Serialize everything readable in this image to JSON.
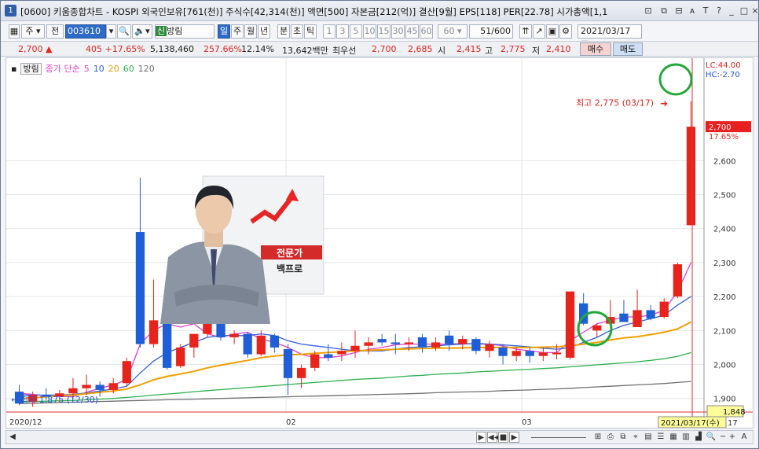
{
  "titlebar": {
    "number": "1",
    "text": "[0600] 키움종합차트 - KOSPI 외국인보유[761(천)] 주식수[42,314(천)] 액면[500] 자본금[212(억)] 결산[9월] EPS[118] PER[22.78] 시가총액[1,1"
  },
  "window_buttons": [
    "⊡",
    "⧉",
    "⊟",
    "ᴀ",
    "T",
    "?",
    "_",
    "□",
    "×"
  ],
  "toolbar": {
    "type": "주",
    "mode": "전",
    "code": "003610",
    "name_badge": "신",
    "name": "방림",
    "periods": [
      "일",
      "주",
      "월",
      "년",
      "분",
      "초",
      "틱"
    ],
    "period_selected": "일",
    "intervals": [
      "1",
      "3",
      "5",
      "10",
      "15",
      "30",
      "45",
      "60"
    ],
    "interval_value": "60",
    "count": "51",
    "count_total": "/600",
    "date": "2021/03/17"
  },
  "quote": {
    "price": "2,700",
    "arrow": "▲",
    "change": "405",
    "rate": "+17.65%",
    "volume": "5,138,460",
    "vol_rate": "257.66%",
    "turnover": "12.14%",
    "amount": "13,642백만",
    "pref_label": "최우선",
    "ask": "2,700",
    "bid": "2,685",
    "open_label": "시",
    "open": "2,415",
    "high_label": "고",
    "high": "2,775",
    "low_label": "저",
    "low": "2,410",
    "buy": "매수",
    "sell": "매도"
  },
  "legend": {
    "name": "방림",
    "title": "종가 단순",
    "ma": [
      {
        "label": "5",
        "color": "#e040d0"
      },
      {
        "label": "10",
        "color": "#3060e0"
      },
      {
        "label": "20",
        "color": "#f0a000"
      },
      {
        "label": "60",
        "color": "#30b050"
      },
      {
        "label": "120",
        "color": "#707070"
      }
    ]
  },
  "chart_data": {
    "type": "candlestick",
    "title": "방림",
    "ylim": [
      1860,
      2860
    ],
    "yticks": [
      1900,
      2000,
      2100,
      2200,
      2300,
      2400,
      2500,
      2600
    ],
    "xlabels": [
      "2020/12",
      "02",
      "03"
    ],
    "candles": [
      {
        "o": 1920,
        "h": 1940,
        "l": 1880,
        "c": 1885
      },
      {
        "o": 1890,
        "h": 1920,
        "l": 1875,
        "c": 1910
      },
      {
        "o": 1910,
        "h": 1930,
        "l": 1895,
        "c": 1905
      },
      {
        "o": 1905,
        "h": 1925,
        "l": 1890,
        "c": 1915
      },
      {
        "o": 1915,
        "h": 1960,
        "l": 1900,
        "c": 1930
      },
      {
        "o": 1930,
        "h": 1970,
        "l": 1910,
        "c": 1940
      },
      {
        "o": 1940,
        "h": 1950,
        "l": 1905,
        "c": 1925
      },
      {
        "o": 1925,
        "h": 1960,
        "l": 1915,
        "c": 1945
      },
      {
        "o": 1945,
        "h": 2020,
        "l": 1935,
        "c": 2010
      },
      {
        "o": 2390,
        "h": 2550,
        "l": 2050,
        "c": 2060
      },
      {
        "o": 2060,
        "h": 2250,
        "l": 2050,
        "c": 2130
      },
      {
        "o": 2130,
        "h": 2130,
        "l": 1985,
        "c": 1990
      },
      {
        "o": 1995,
        "h": 2060,
        "l": 1990,
        "c": 2050
      },
      {
        "o": 2050,
        "h": 2080,
        "l": 2020,
        "c": 2090
      },
      {
        "o": 2090,
        "h": 2150,
        "l": 2080,
        "c": 2120
      },
      {
        "o": 2130,
        "h": 2145,
        "l": 2070,
        "c": 2080
      },
      {
        "o": 2080,
        "h": 2100,
        "l": 2060,
        "c": 2090
      },
      {
        "o": 2090,
        "h": 2095,
        "l": 2020,
        "c": 2030
      },
      {
        "o": 2030,
        "h": 2100,
        "l": 2025,
        "c": 2085
      },
      {
        "o": 2085,
        "h": 2090,
        "l": 2035,
        "c": 2050
      },
      {
        "o": 2045,
        "h": 2060,
        "l": 1910,
        "c": 1960
      },
      {
        "o": 1960,
        "h": 2000,
        "l": 1930,
        "c": 1990
      },
      {
        "o": 1990,
        "h": 2040,
        "l": 1980,
        "c": 2030
      },
      {
        "o": 2030,
        "h": 2060,
        "l": 2010,
        "c": 2020
      },
      {
        "o": 2030,
        "h": 2065,
        "l": 2010,
        "c": 2040
      },
      {
        "o": 2040,
        "h": 2100,
        "l": 2020,
        "c": 2055
      },
      {
        "o": 2055,
        "h": 2080,
        "l": 2030,
        "c": 2065
      },
      {
        "o": 2075,
        "h": 2090,
        "l": 2055,
        "c": 2065
      },
      {
        "o": 2065,
        "h": 2090,
        "l": 2030,
        "c": 2060
      },
      {
        "o": 2060,
        "h": 2080,
        "l": 2040,
        "c": 2065
      },
      {
        "o": 2080,
        "h": 2090,
        "l": 2035,
        "c": 2050
      },
      {
        "o": 2050,
        "h": 2080,
        "l": 2040,
        "c": 2065
      },
      {
        "o": 2085,
        "h": 2100,
        "l": 2040,
        "c": 2060
      },
      {
        "o": 2060,
        "h": 2085,
        "l": 2045,
        "c": 2075
      },
      {
        "o": 2075,
        "h": 2080,
        "l": 2030,
        "c": 2040
      },
      {
        "o": 2040,
        "h": 2070,
        "l": 2020,
        "c": 2060
      },
      {
        "o": 2050,
        "h": 2060,
        "l": 2000,
        "c": 2025
      },
      {
        "o": 2025,
        "h": 2050,
        "l": 2010,
        "c": 2040
      },
      {
        "o": 2040,
        "h": 2050,
        "l": 2005,
        "c": 2025
      },
      {
        "o": 2025,
        "h": 2050,
        "l": 2010,
        "c": 2035
      },
      {
        "o": 2030,
        "h": 2060,
        "l": 2015,
        "c": 2035
      },
      {
        "o": 2020,
        "h": 2210,
        "l": 2015,
        "c": 2215
      },
      {
        "o": 2180,
        "h": 2210,
        "l": 2115,
        "c": 2120
      },
      {
        "o": 2100,
        "h": 2120,
        "l": 2080,
        "c": 2115
      },
      {
        "o": 2120,
        "h": 2190,
        "l": 2110,
        "c": 2140
      },
      {
        "o": 2150,
        "h": 2190,
        "l": 2130,
        "c": 2125
      },
      {
        "o": 2110,
        "h": 2220,
        "l": 2110,
        "c": 2160
      },
      {
        "o": 2160,
        "h": 2175,
        "l": 2130,
        "c": 2135
      },
      {
        "o": 2140,
        "h": 2195,
        "l": 2135,
        "c": 2185
      },
      {
        "o": 2200,
        "h": 2300,
        "l": 2195,
        "c": 2295
      },
      {
        "o": 2410,
        "h": 2775,
        "l": 2410,
        "c": 2700
      }
    ],
    "ma5": [
      1915,
      1912,
      1908,
      1906,
      1905,
      1918,
      1930,
      1940,
      1955,
      2060,
      2100,
      2120,
      2110,
      2120,
      2090,
      2080,
      2090,
      2095,
      2075,
      2065,
      2050,
      2030,
      2020,
      2020,
      2025,
      2035,
      2045,
      2050,
      2058,
      2060,
      2060,
      2060,
      2060,
      2062,
      2060,
      2060,
      2055,
      2045,
      2040,
      2035,
      2035,
      2070,
      2095,
      2120,
      2130,
      2140,
      2140,
      2145,
      2160,
      2215,
      2300
    ],
    "ma10": [
      1910,
      1910,
      1910,
      1910,
      1912,
      1916,
      1922,
      1928,
      1936,
      1975,
      2010,
      2035,
      2050,
      2065,
      2080,
      2085,
      2085,
      2085,
      2090,
      2085,
      2070,
      2060,
      2055,
      2050,
      2045,
      2040,
      2040,
      2040,
      2045,
      2050,
      2052,
      2055,
      2058,
      2060,
      2062,
      2060,
      2058,
      2055,
      2052,
      2048,
      2045,
      2050,
      2065,
      2080,
      2100,
      2115,
      2125,
      2135,
      2145,
      2175,
      2200
    ],
    "ma20": [
      1900,
      1902,
      1905,
      1908,
      1910,
      1914,
      1918,
      1922,
      1928,
      1940,
      1955,
      1965,
      1972,
      1980,
      1990,
      1998,
      2005,
      2012,
      2020,
      2025,
      2028,
      2030,
      2033,
      2035,
      2038,
      2040,
      2042,
      2043,
      2045,
      2046,
      2047,
      2048,
      2048,
      2049,
      2050,
      2050,
      2050,
      2050,
      2050,
      2051,
      2052,
      2055,
      2060,
      2065,
      2072,
      2078,
      2082,
      2088,
      2095,
      2105,
      2125
    ],
    "ma60": [
      1890,
      1891,
      1892,
      1893,
      1894,
      1896,
      1898,
      1900,
      1903,
      1906,
      1910,
      1913,
      1916,
      1920,
      1923,
      1926,
      1929,
      1932,
      1935,
      1938,
      1941,
      1944,
      1947,
      1950,
      1953,
      1956,
      1958,
      1960,
      1963,
      1966,
      1968,
      1971,
      1973,
      1975,
      1978,
      1980,
      1982,
      1984,
      1986,
      1988,
      1990,
      1993,
      1996,
      1999,
      2002,
      2005,
      2008,
      2012,
      2017,
      2024,
      2035
    ],
    "ma120": [
      1885,
      1886,
      1887,
      1888,
      1889,
      1890,
      1891,
      1892,
      1893,
      1894,
      1895,
      1896,
      1897,
      1898,
      1899,
      1900,
      1901,
      1902,
      1903,
      1904,
      1905,
      1906,
      1907,
      1908,
      1909,
      1910,
      1911,
      1912,
      1913,
      1914,
      1915,
      1917,
      1918,
      1919,
      1920,
      1921,
      1923,
      1924,
      1925,
      1927,
      1928,
      1930,
      1932,
      1934,
      1936,
      1938,
      1940,
      1942,
      1944,
      1947,
      1950
    ],
    "annot_high": "최고 2,775 (03/17)",
    "annot_low": "최저 1,875 (12/30)",
    "lc": "LC:44.00",
    "hc": "HC:-2.70",
    "last_price": "2,700",
    "last_rate": "17.65%",
    "cursor_price": "1,848",
    "cursor_date": "2021/03/17(수)",
    "cursor_date_suffix": "17"
  },
  "ad": {
    "badge1": "전문가",
    "badge2": "백프로"
  }
}
